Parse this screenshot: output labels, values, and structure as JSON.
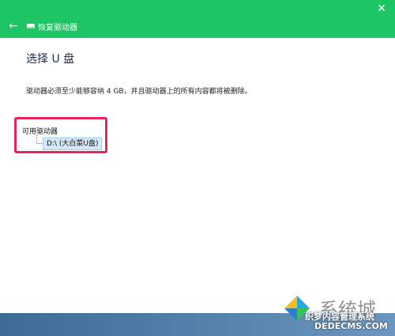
{
  "window": {
    "title": "恢复驱动器",
    "back_glyph": "←",
    "close_glyph": "✕"
  },
  "content": {
    "heading": "选择 U 盘",
    "description": "驱动器必须至少能够容纳 4 GB，并且驱动器上的所有内容都将被删除。",
    "tree": {
      "root_label": "可用驱动器",
      "items": [
        {
          "label": "D:\\ (大白菜U盘)",
          "selected": true
        }
      ]
    }
  },
  "watermark": {
    "large_text": "系统城",
    "mid_text": "织梦内容管理系统",
    "url_text": "DEDECMS.COM"
  },
  "colors": {
    "titlebar": "#1ec564",
    "highlight_border": "#e8245e",
    "selection_bg": "#d6e8f8"
  }
}
